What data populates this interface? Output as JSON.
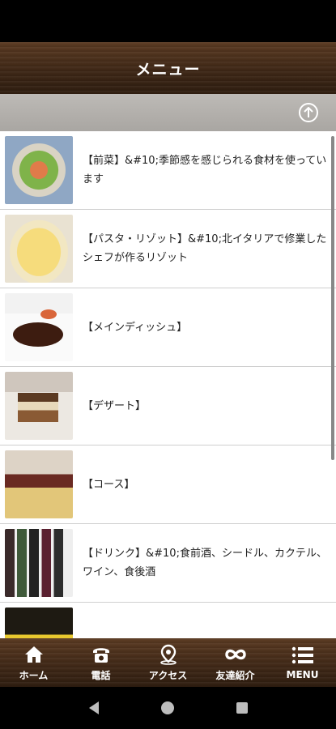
{
  "header": {
    "title": "メニュー"
  },
  "subbar": {
    "scroll_top_icon": "arrow-up-circle-icon"
  },
  "menu_items": [
    {
      "label": "【前菜】&#10;季節感を感じられる食材を使っています",
      "thumb": "appetizer-photo"
    },
    {
      "label": "【パスタ・リゾット】&#10;北イタリアで修業したシェフが作るリゾット",
      "thumb": "pasta-photo"
    },
    {
      "label": "【メインディッシュ】",
      "thumb": "main-dish-photo"
    },
    {
      "label": "【デザート】",
      "thumb": "dessert-photo"
    },
    {
      "label": "【コース】",
      "thumb": "course-photo"
    },
    {
      "label": "【ドリンク】&#10;食前酒、シードル、カクテル、ワイン、食後酒",
      "thumb": "drink-photo"
    },
    {
      "label": "",
      "thumb": "partial-photo"
    }
  ],
  "bottom_nav": [
    {
      "label": "ホーム",
      "icon": "home-icon"
    },
    {
      "label": "電話",
      "icon": "phone-icon"
    },
    {
      "label": "アクセス",
      "icon": "map-pin-icon"
    },
    {
      "label": "友達紹介",
      "icon": "infinity-icon"
    },
    {
      "label": "MENU",
      "icon": "menu-icon"
    }
  ],
  "system_nav": [
    "back-icon",
    "home-circle-icon",
    "recents-icon"
  ]
}
